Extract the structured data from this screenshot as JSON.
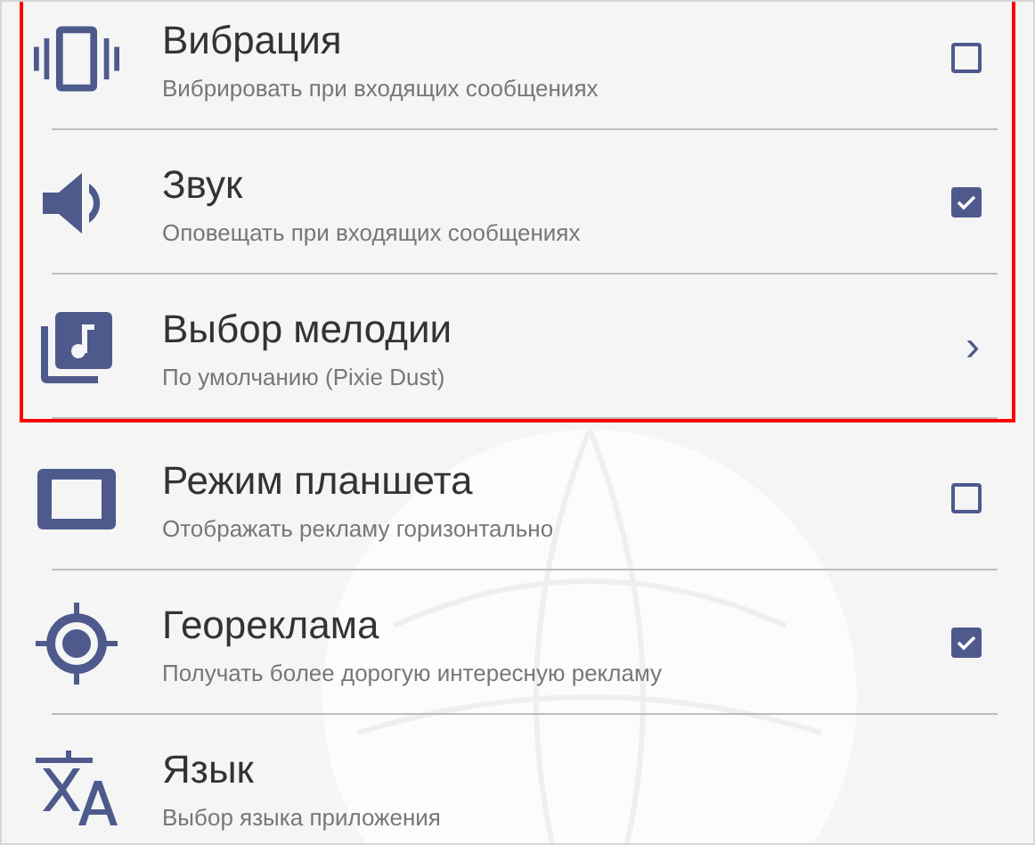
{
  "groups": [
    {
      "highlighted": true,
      "items": [
        {
          "kind": "checkbox",
          "title": "Вибрация",
          "subtitle": "Вибрировать при входящих сообщениях",
          "checked": false
        },
        {
          "kind": "checkbox",
          "title": "Звук",
          "subtitle": "Оповещать при входящих сообщениях",
          "checked": true
        },
        {
          "kind": "link",
          "title": "Выбор мелодии",
          "subtitle": "По умолчанию (Pixie Dust)",
          "chevron": "›"
        }
      ]
    },
    {
      "highlighted": false,
      "items": [
        {
          "kind": "checkbox",
          "title": "Режим планшета",
          "subtitle": "Отображать рекламу горизонтально",
          "checked": false
        },
        {
          "kind": "checkbox",
          "title": "Геореклама",
          "subtitle": "Получать более дорогую интересную рекламу",
          "checked": true
        },
        {
          "kind": "plain",
          "title": "Язык",
          "subtitle": "Выбор языка приложения"
        }
      ]
    }
  ]
}
